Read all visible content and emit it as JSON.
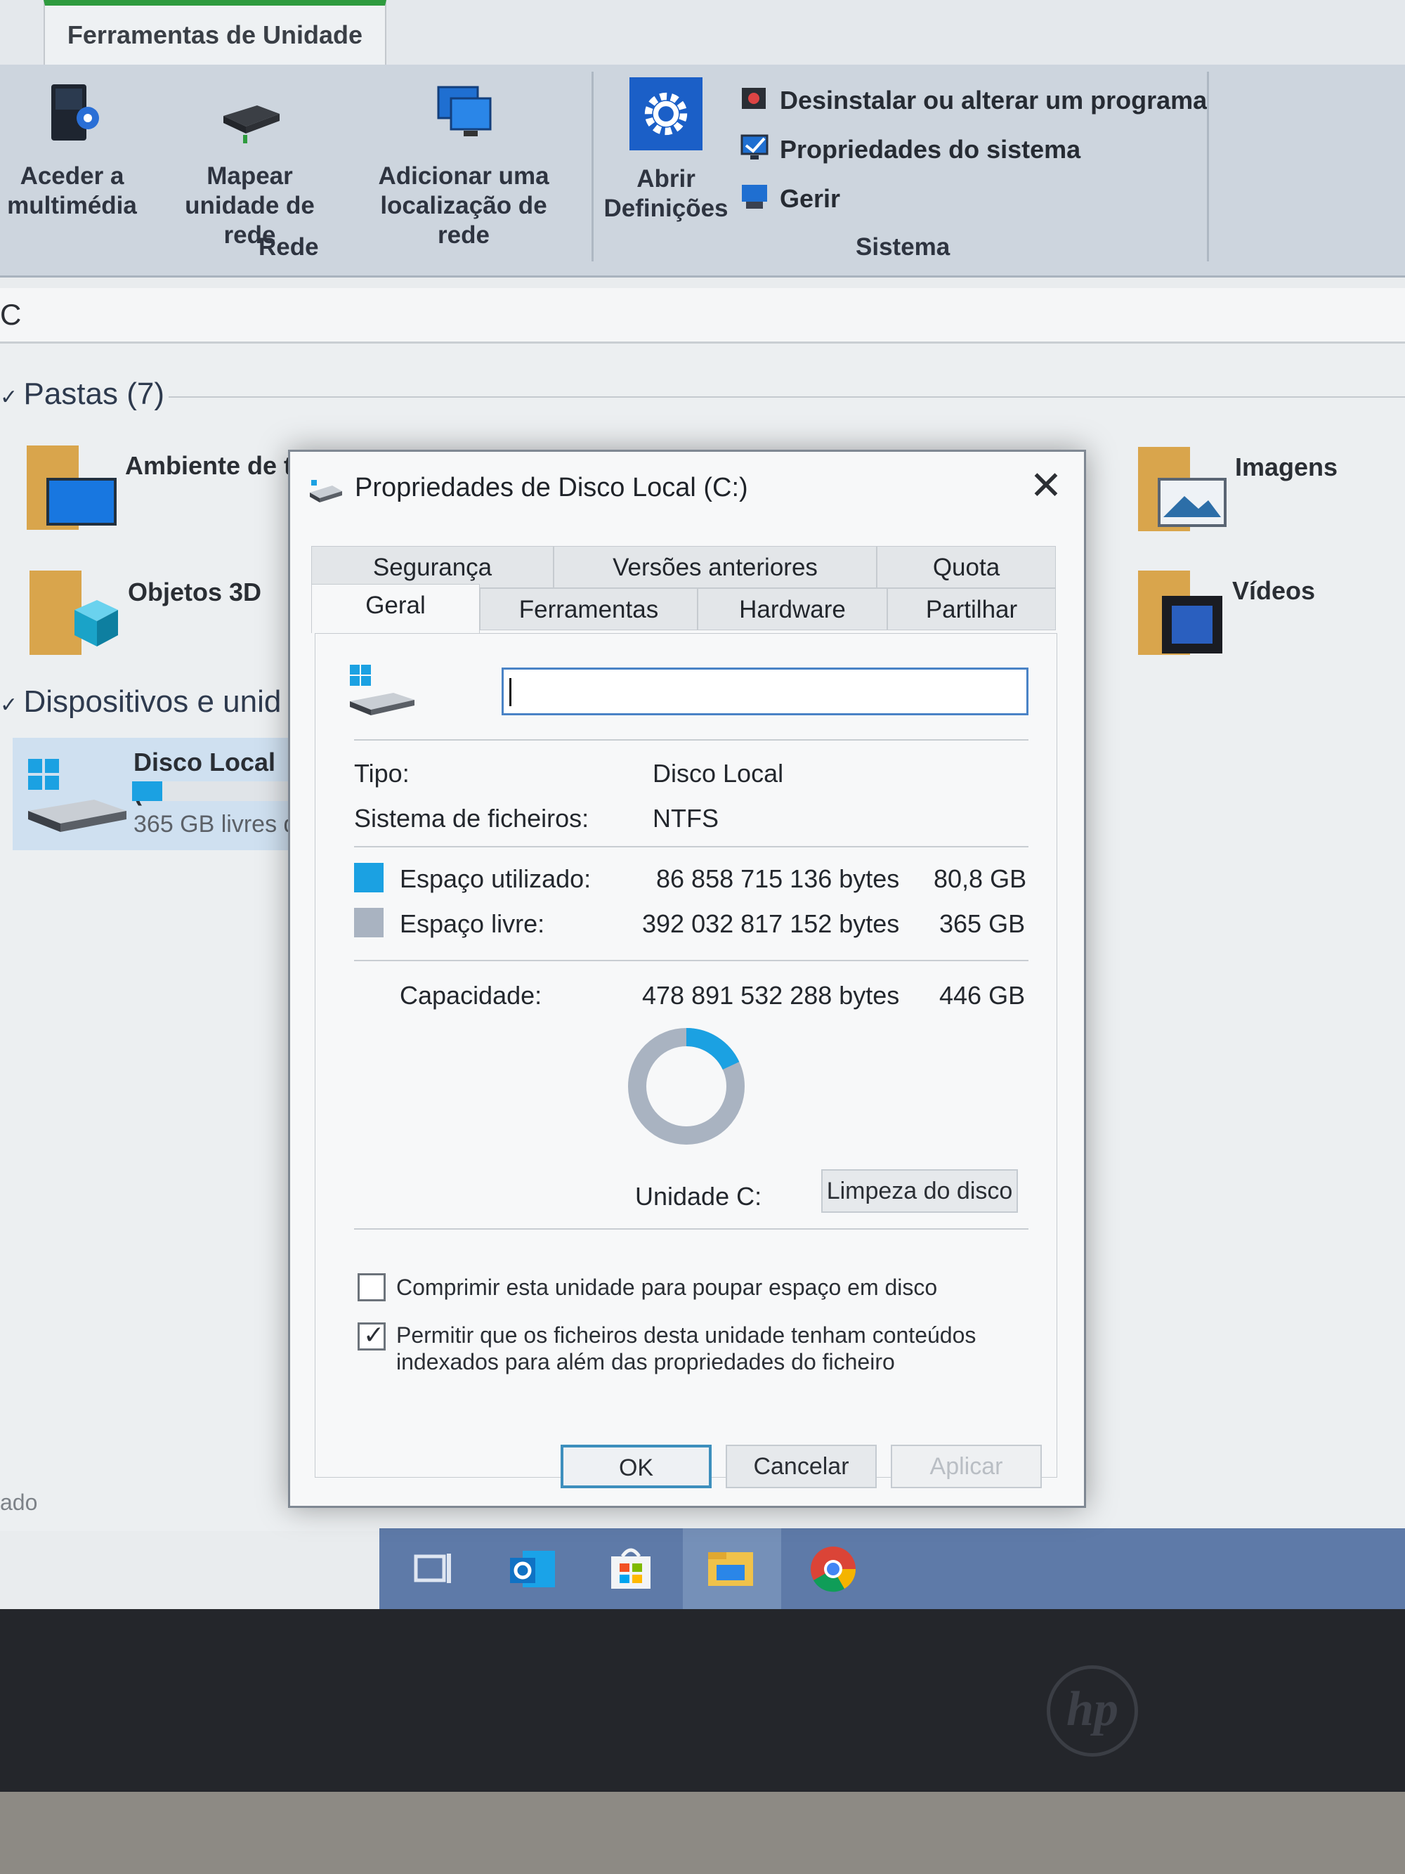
{
  "ribbon": {
    "context_tab": "Ferramentas de Unidade",
    "buttons": {
      "media": "Aceder a multimédia",
      "map_drive": "Mapear unidade de rede",
      "add_location": "Adicionar uma localização de rede",
      "settings": "Abrir Definições"
    },
    "groups": {
      "network": "Rede",
      "system": "Sistema"
    },
    "system_items": [
      "Desinstalar ou alterar um programa",
      "Propriedades do sistema",
      "Gerir"
    ]
  },
  "address": {
    "text": "C"
  },
  "explorer": {
    "folders_header": "Pastas (7)",
    "folders": [
      "Ambiente de t",
      "Objetos 3D",
      "Imagens",
      "Vídeos"
    ],
    "devices_header": "Dispositivos e unid",
    "drive_name": "Disco Local (C",
    "drive_free": "365 GB livres d",
    "drive_used_fraction": 0.18,
    "status_left": "ado"
  },
  "dialog": {
    "title": "Propriedades de Disco Local (C:)",
    "tabs_row1": [
      "Segurança",
      "Versões anteriores",
      "Quota"
    ],
    "tabs_row2": [
      "Geral",
      "Ferramentas",
      "Hardware",
      "Partilhar"
    ],
    "active_tab": "Geral",
    "name_value": "",
    "type_label": "Tipo:",
    "type_value": "Disco Local",
    "fs_label": "Sistema de ficheiros:",
    "fs_value": "NTFS",
    "used_label": "Espaço utilizado:",
    "used_bytes": "86 858 715 136 bytes",
    "used_gb": "80,8 GB",
    "free_label": "Espaço livre:",
    "free_bytes": "392 032 817 152 bytes",
    "free_gb": "365 GB",
    "capacity_label": "Capacidade:",
    "capacity_bytes": "478 891 532 288 bytes",
    "capacity_gb": "446 GB",
    "used_fraction": 0.181,
    "drive_label": "Unidade C:",
    "cleanup_button": "Limpeza do disco",
    "compress_label": "Comprimir esta unidade para poupar espaço em disco",
    "compress_checked": false,
    "index_label_line1": "Permitir que os ficheiros desta unidade tenham conteúdos",
    "index_label_line2": "indexados para além das propriedades do ficheiro",
    "index_checked": true,
    "ok": "OK",
    "cancel": "Cancelar",
    "apply": "Aplicar",
    "colors": {
      "used": "#1ba1e2",
      "free": "#a9b3c1"
    }
  },
  "bezel": {
    "logo": "hp"
  }
}
